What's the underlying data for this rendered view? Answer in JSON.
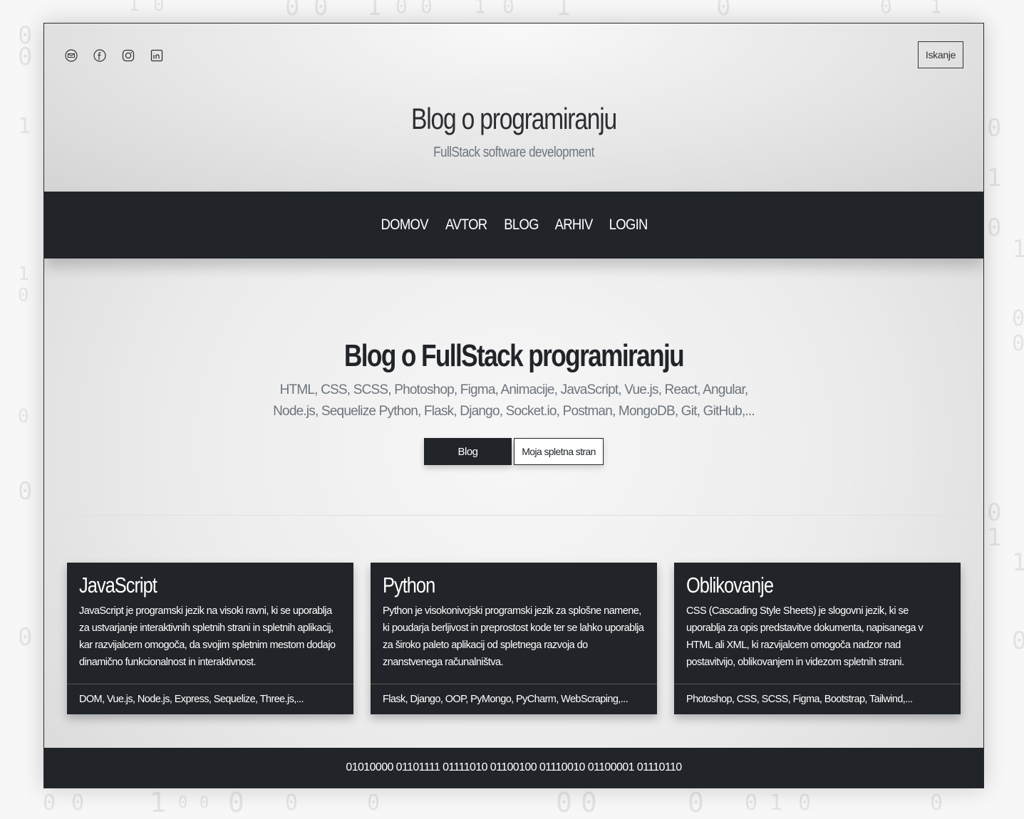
{
  "header": {
    "title": "Blog o programiranju",
    "subtitle": "FullStack software development",
    "search_label": "Iskanje",
    "social_icons": [
      "email-icon",
      "facebook-icon",
      "instagram-icon",
      "linkedin-icon"
    ]
  },
  "nav": {
    "items": [
      {
        "label": "DOMOV"
      },
      {
        "label": "AVTOR"
      },
      {
        "label": "BLOG"
      },
      {
        "label": "ARHIV"
      },
      {
        "label": "LOGIN"
      }
    ]
  },
  "hero": {
    "title": "Blog o FullStack programiranju",
    "description": "HTML, CSS, SCSS, Photoshop, Figma, Animacije, JavaScript, Vue.js, React, Angular, Node.js, Sequelize Python, Flask, Django, Socket.io, Postman, MongoDB, Git, GitHub,...",
    "btn_primary": "Blog",
    "btn_secondary": "Moja spletna stran"
  },
  "cards": [
    {
      "title": "JavaScript",
      "text": "JavaScript je programski jezik na visoki ravni, ki se uporablja za ustvarjanje interaktivnih spletnih strani in spletnih aplikacij, kar razvijalcem omogoča, da svojim spletnim mestom dodajo dinamično funkcionalnost in interaktivnost.",
      "tags": "DOM, Vue.js, Node.js, Express, Sequelize, Three.js,..."
    },
    {
      "title": "Python",
      "text": "Python je visokonivojski programski jezik za splošne namene, ki poudarja berljivost in preprostost kode ter se lahko uporablja za široko paleto aplikacij od spletnega razvoja do znanstvenega računalništva.",
      "tags": "Flask, Django, OOP, PyMongo, PyCharm, WebScraping,..."
    },
    {
      "title": "Oblikovanje",
      "text": "CSS (Cascading Style Sheets) je slogovni jezik, ki se uporablja za opis predstavitve dokumenta, napisanega v HTML ali XML, ki razvijalcem omogoča nadzor nad postavitvijo, oblikovanjem in videzom spletnih strani.",
      "tags": "Photoshop, CSS, SCSS, Figma, Bootstrap, Tailwind,..."
    }
  ],
  "footer": {
    "text": "01010000 01101111 01111010 01100100 01110010 01100001 01110110"
  },
  "colors": {
    "dark": "#212529",
    "muted": "#6c757d"
  }
}
